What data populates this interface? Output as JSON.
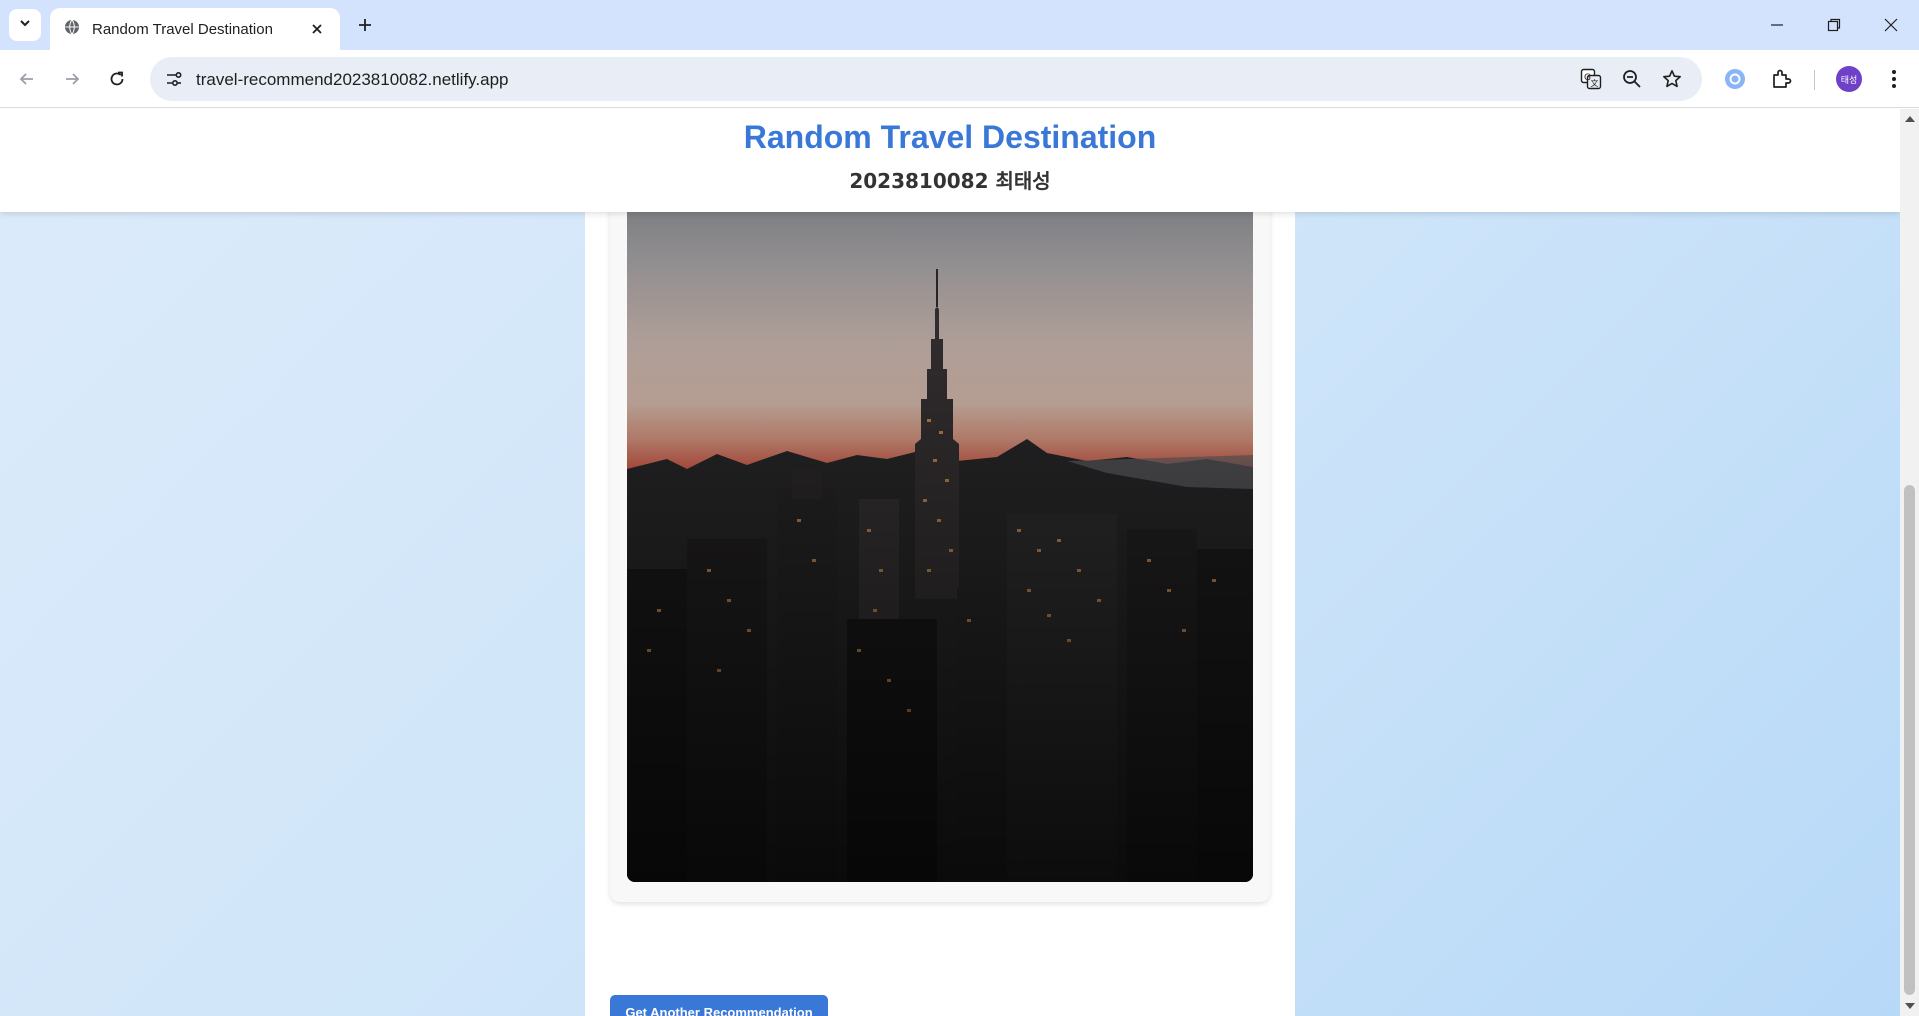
{
  "browser": {
    "tab_title": "Random Travel Destination",
    "url": "travel-recommend2023810082.netlify.app",
    "profile_initials": "태성"
  },
  "page": {
    "title": "Random Travel Destination",
    "subtitle": "2023810082 최태성",
    "button_label": "Get Another Recommendation"
  },
  "colors": {
    "accent": "#3a78d8",
    "background_light": "#dcebfa",
    "background_dark": "#b7d9f8"
  },
  "icons": [
    "tab-search-icon",
    "globe-icon",
    "close-icon",
    "plus-icon",
    "minimize-icon",
    "restore-icon",
    "back-icon",
    "forward-icon",
    "reload-icon",
    "site-info-icon",
    "translate-icon",
    "zoom-out-icon",
    "star-icon",
    "lens-icon",
    "extensions-icon",
    "menu-icon"
  ]
}
